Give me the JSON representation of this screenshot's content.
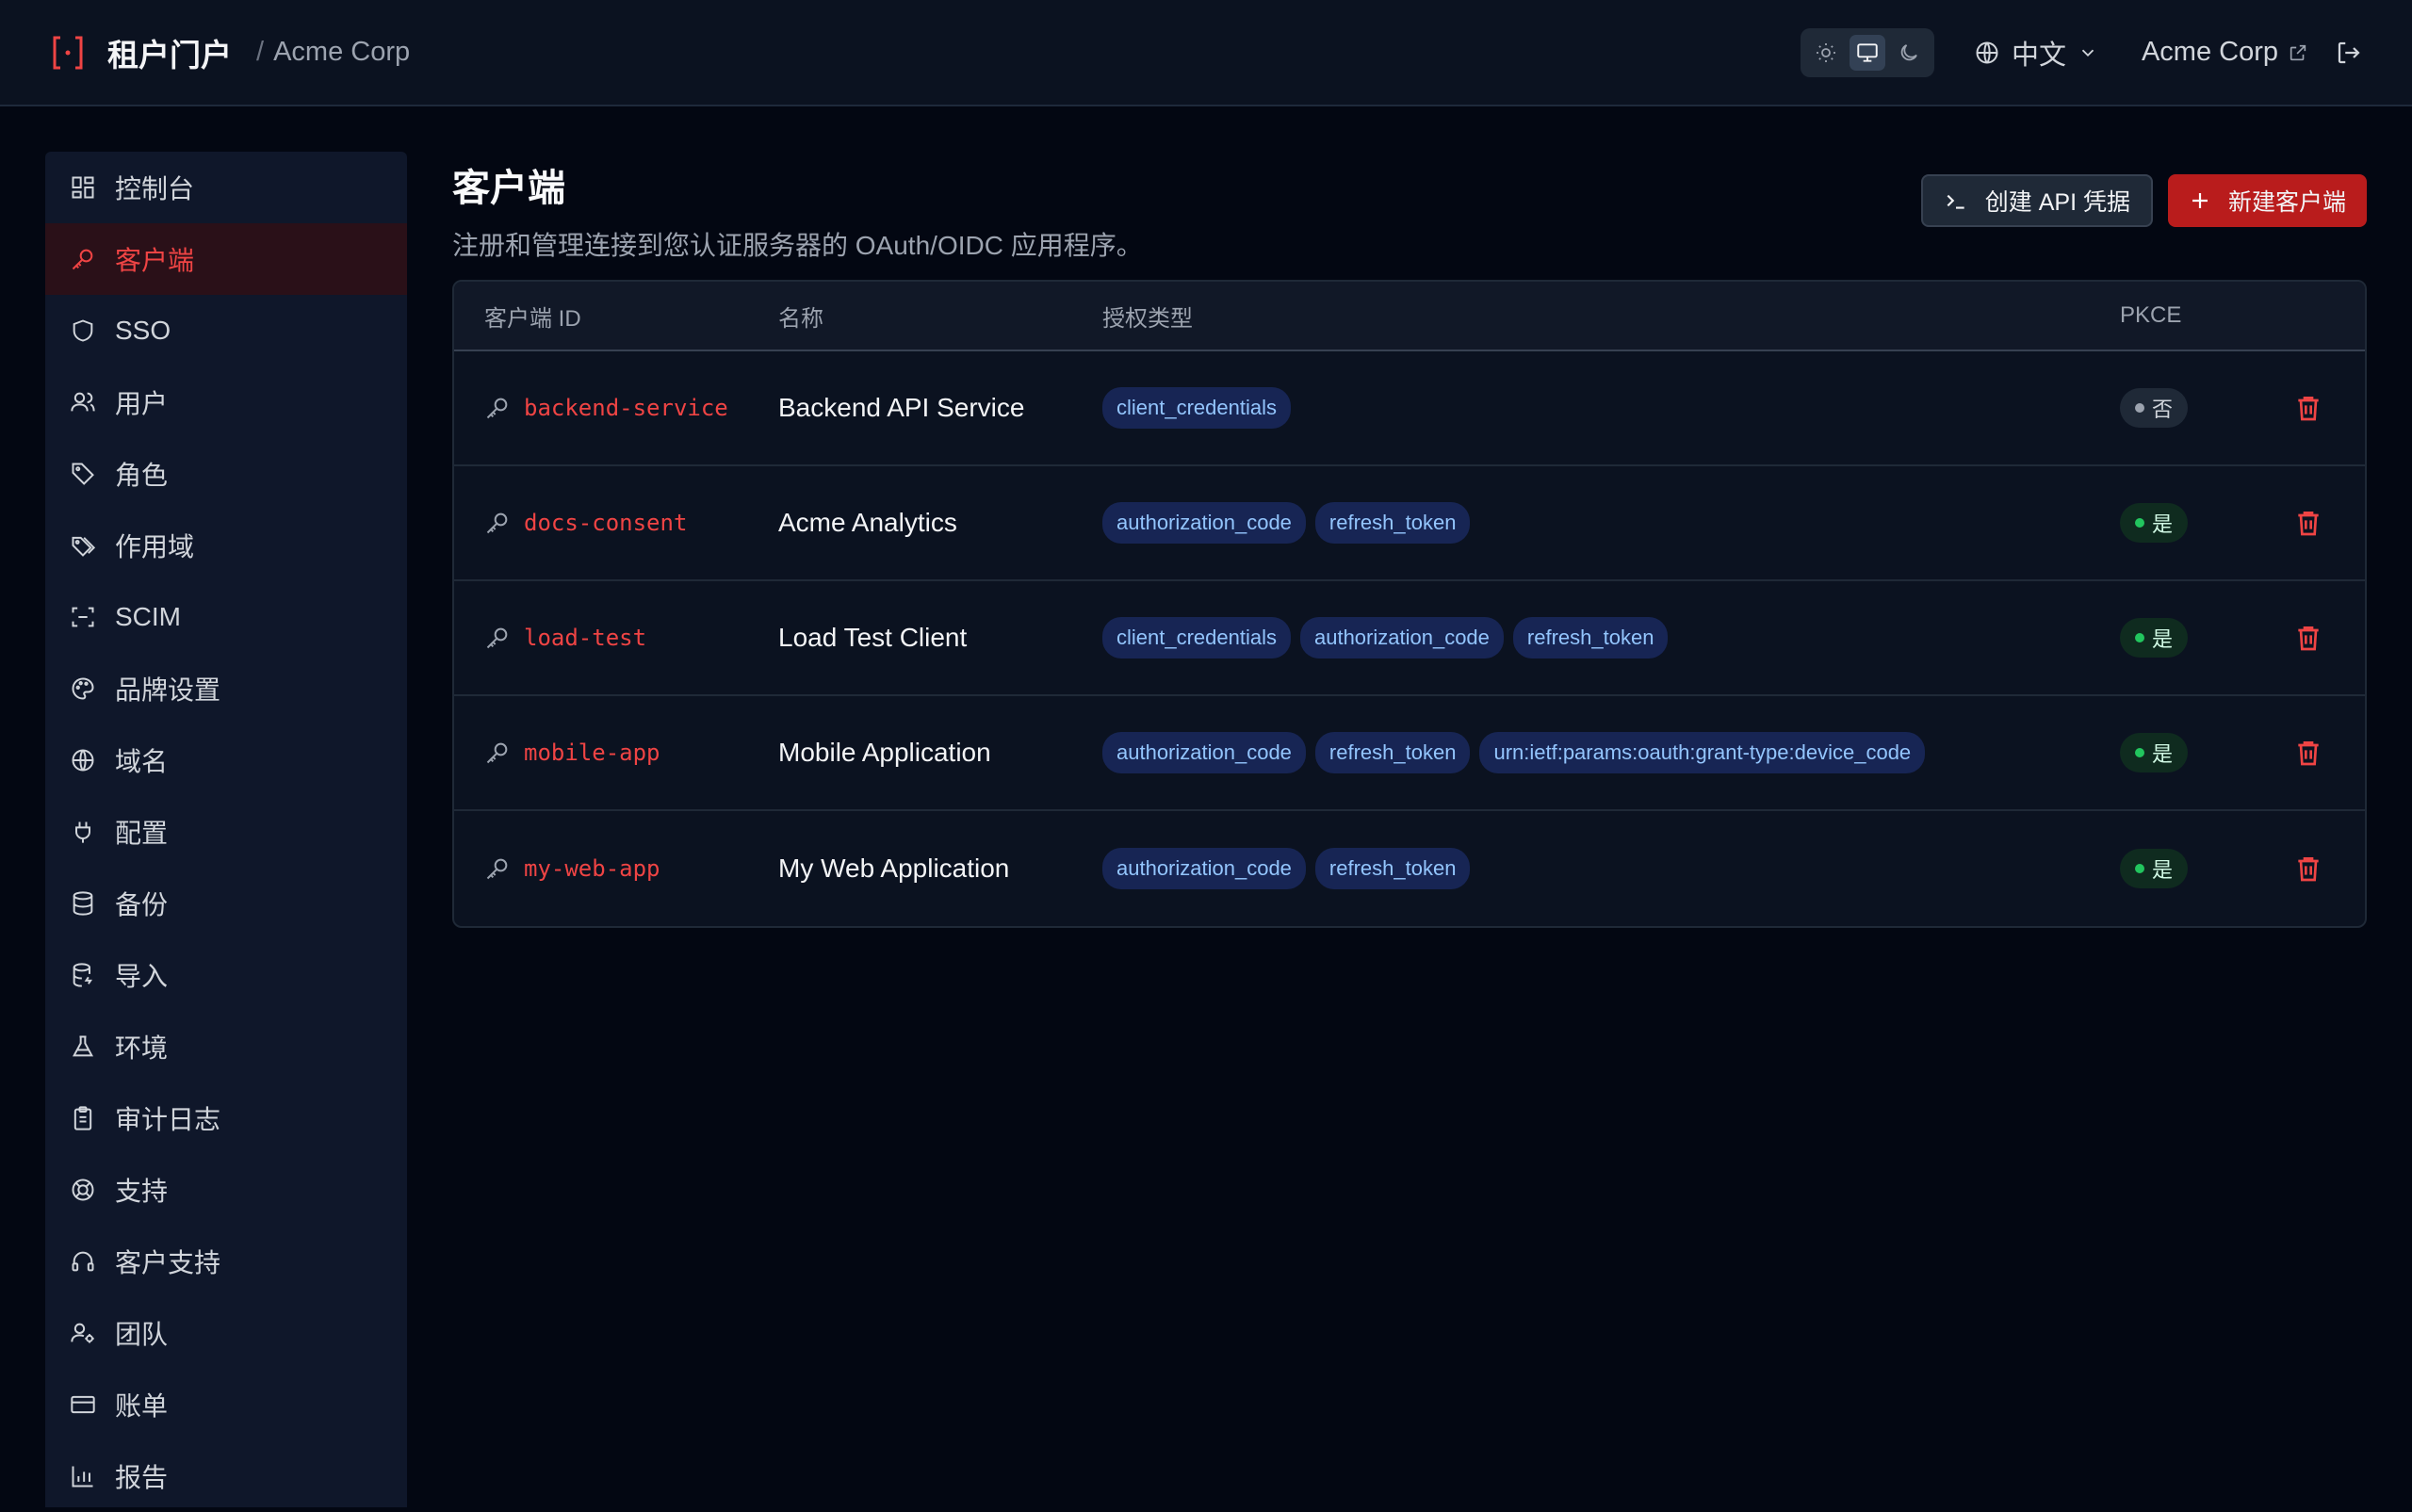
{
  "header": {
    "title": "租户门户",
    "separator": "/",
    "tenant": "Acme Corp",
    "language": "中文",
    "tenant_link": "Acme Corp"
  },
  "sidebar": {
    "items": [
      {
        "label": "控制台",
        "icon": "dashboard-icon"
      },
      {
        "label": "客户端",
        "icon": "key-icon",
        "active": true
      },
      {
        "label": "SSO",
        "icon": "shield-icon"
      },
      {
        "label": "用户",
        "icon": "users-icon"
      },
      {
        "label": "角色",
        "icon": "tag-icon"
      },
      {
        "label": "作用域",
        "icon": "tags-icon"
      },
      {
        "label": "SCIM",
        "icon": "scan-icon"
      },
      {
        "label": "品牌设置",
        "icon": "palette-icon"
      },
      {
        "label": "域名",
        "icon": "globe-icon"
      },
      {
        "label": "配置",
        "icon": "plug-icon"
      },
      {
        "label": "备份",
        "icon": "database-icon"
      },
      {
        "label": "导入",
        "icon": "database-import-icon"
      },
      {
        "label": "环境",
        "icon": "flask-icon"
      },
      {
        "label": "审计日志",
        "icon": "clipboard-icon"
      },
      {
        "label": "支持",
        "icon": "lifebuoy-icon"
      },
      {
        "label": "客户支持",
        "icon": "headset-icon"
      },
      {
        "label": "团队",
        "icon": "user-gear-icon"
      },
      {
        "label": "账单",
        "icon": "credit-card-icon"
      },
      {
        "label": "报告",
        "icon": "bar-chart-icon"
      }
    ]
  },
  "page": {
    "title": "客户端",
    "subtitle": "注册和管理连接到您认证服务器的 OAuth/OIDC 应用程序。",
    "create_api_label": "创建 API 凭据",
    "new_client_label": "新建客户端"
  },
  "table": {
    "headers": {
      "id": "客户端 ID",
      "name": "名称",
      "grants": "授权类型",
      "pkce": "PKCE"
    },
    "rows": [
      {
        "id": "backend-service",
        "name": "Backend API Service",
        "grants": [
          "client_credentials"
        ],
        "pkce": "否",
        "pkce_on": false
      },
      {
        "id": "docs-consent",
        "name": "Acme Analytics",
        "grants": [
          "authorization_code",
          "refresh_token"
        ],
        "pkce": "是",
        "pkce_on": true
      },
      {
        "id": "load-test",
        "name": "Load Test Client",
        "grants": [
          "client_credentials",
          "authorization_code",
          "refresh_token"
        ],
        "pkce": "是",
        "pkce_on": true
      },
      {
        "id": "mobile-app",
        "name": "Mobile Application",
        "grants": [
          "authorization_code",
          "refresh_token",
          "urn:ietf:params:oauth:grant-type:device_code"
        ],
        "pkce": "是",
        "pkce_on": true
      },
      {
        "id": "my-web-app",
        "name": "My Web Application",
        "grants": [
          "authorization_code",
          "refresh_token"
        ],
        "pkce": "是",
        "pkce_on": true
      }
    ]
  },
  "colors": {
    "accent": "#ef4444",
    "primary_button": "#b91c1c",
    "grant_bg": "#172554",
    "grant_text": "#93c5fd",
    "pkce_yes": "#22c55e"
  }
}
